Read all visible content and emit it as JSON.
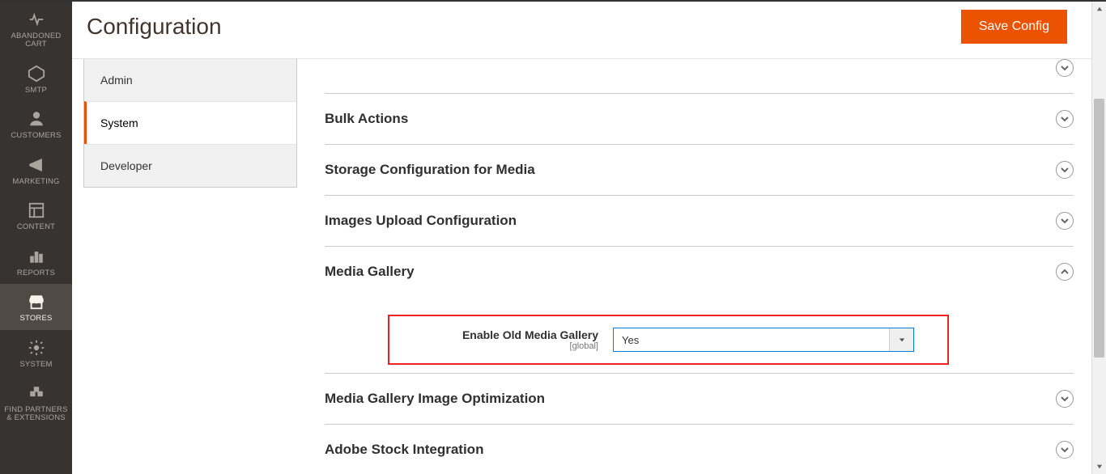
{
  "header": {
    "title": "Configuration",
    "save_label": "Save Config"
  },
  "sidebar": {
    "items": [
      {
        "label": "ABANDONED CART"
      },
      {
        "label": "SMTP"
      },
      {
        "label": "CUSTOMERS"
      },
      {
        "label": "MARKETING"
      },
      {
        "label": "CONTENT"
      },
      {
        "label": "REPORTS"
      },
      {
        "label": "STORES"
      },
      {
        "label": "SYSTEM"
      },
      {
        "label": "FIND PARTNERS & EXTENSIONS"
      }
    ]
  },
  "config_tabs": {
    "items": [
      {
        "label": "Admin"
      },
      {
        "label": "System"
      },
      {
        "label": "Developer"
      }
    ]
  },
  "sections": {
    "bulk_actions": "Bulk Actions",
    "storage_media": "Storage Configuration for Media",
    "images_upload": "Images Upload Configuration",
    "media_gallery": "Media Gallery",
    "media_opt": "Media Gallery Image Optimization",
    "adobe_stock": "Adobe Stock Integration"
  },
  "media_gallery_field": {
    "label": "Enable Old Media Gallery",
    "scope": "[global]",
    "value": "Yes"
  }
}
